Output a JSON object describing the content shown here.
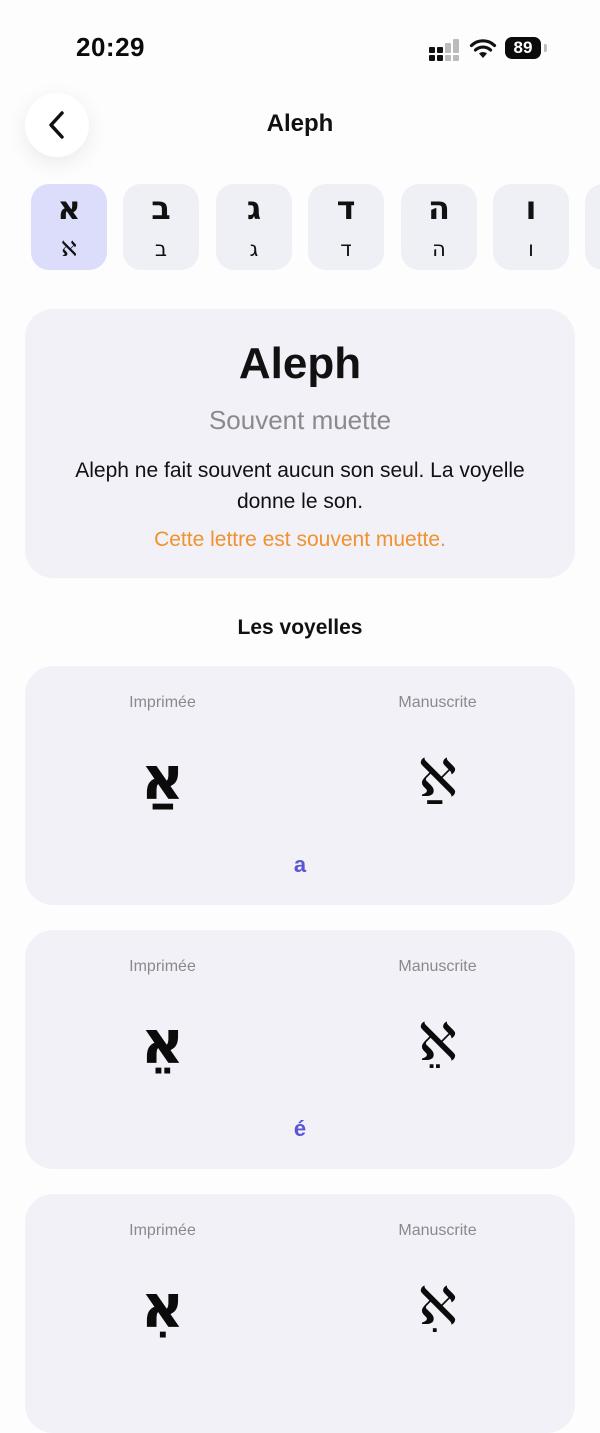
{
  "status_bar": {
    "time": "20:29",
    "battery": "89"
  },
  "header": {
    "title": "Aleph"
  },
  "letters": [
    {
      "printed": "א",
      "cursive": "ℵ",
      "selected": true
    },
    {
      "printed": "ב",
      "cursive": "ב"
    },
    {
      "printed": "ג",
      "cursive": "ג"
    },
    {
      "printed": "ד",
      "cursive": "ד"
    },
    {
      "printed": "ה",
      "cursive": "ה"
    },
    {
      "printed": "ו",
      "cursive": "ו"
    }
  ],
  "intro": {
    "name": "Aleph",
    "subtitle": "Souvent muette",
    "description": "Aleph ne fait souvent aucun son seul. La voyelle donne le son.",
    "note": "Cette lettre est souvent muette."
  },
  "vowels_section": {
    "title": "Les voyelles",
    "printed_label": "Imprimée",
    "cursive_label": "Manuscrite",
    "items": [
      {
        "printed": "אַ",
        "cursive": "ℵַ",
        "sound": "a"
      },
      {
        "printed": "אֵ",
        "cursive": "ℵֵ",
        "sound": "é"
      },
      {
        "printed": "אִ",
        "cursive": "ℵִ",
        "sound": ""
      }
    ]
  },
  "colors": {
    "accent": "#5a55d6",
    "note": "#f0922e",
    "card": "#f1f1f7",
    "selected_tile": "#dcdcfb"
  }
}
